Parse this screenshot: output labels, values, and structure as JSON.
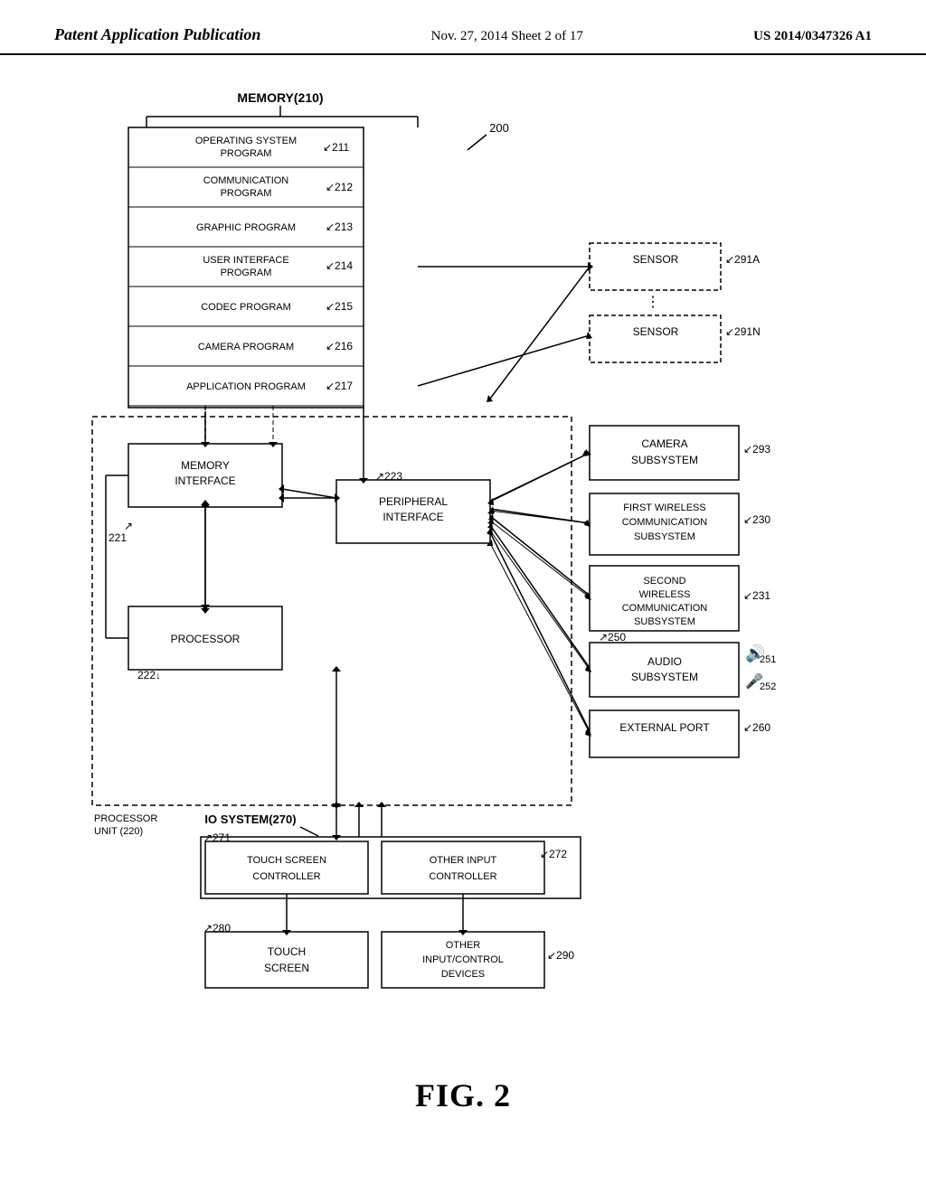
{
  "header": {
    "left": "Patent Application Publication",
    "center": "Nov. 27, 2014   Sheet 2 of 17",
    "right": "US 2014/0347326 A1"
  },
  "figure": {
    "label": "FIG. 2",
    "title": "MEMORY(210)",
    "ref_200": "200",
    "memory_blocks": [
      {
        "id": "211",
        "label": "OPERATING SYSTEM PROGRAM",
        "ref": "211"
      },
      {
        "id": "212",
        "label": "COMMUNICATION PROGRAM",
        "ref": "212"
      },
      {
        "id": "213",
        "label": "GRAPHIC PROGRAM",
        "ref": "213"
      },
      {
        "id": "214",
        "label": "USER INTERFACE PROGRAM",
        "ref": "214"
      },
      {
        "id": "215",
        "label": "CODEC PROGRAM",
        "ref": "215"
      },
      {
        "id": "216",
        "label": "CAMERA PROGRAM",
        "ref": "216"
      },
      {
        "id": "217",
        "label": "APPLICATION PROGRAM",
        "ref": "217"
      }
    ],
    "sensor_291a": "SENSOR",
    "sensor_291a_ref": "291A",
    "sensor_291n": "SENSOR",
    "sensor_291n_ref": "291N",
    "memory_interface": "MEMORY INTERFACE",
    "mi_ref": "221",
    "peripheral_interface": "PERIPHERAL INTERFACE",
    "pi_ref": "223",
    "processor": "PROCESSOR",
    "proc_ref": "222",
    "camera_sub": "CAMERA SUBSYSTEM",
    "camera_ref": "293",
    "first_wireless": "FIRST WIRELESS COMMUNICATION SUBSYSTEM",
    "first_ref": "230",
    "second_wireless": "SECOND WIRELESS COMMUNICATION SUBSYSTEM",
    "second_ref": "231",
    "audio_sub": "AUDIO SUBSYSTEM",
    "audio_ref": "250",
    "external_port": "EXTERNAL PORT",
    "ext_ref": "260",
    "io_system": "IO SYSTEM(270)",
    "touch_ctrl": "TOUCH SCREEN CONTROLLER",
    "touch_ctrl_ref": "271",
    "other_ctrl": "OTHER INPUT CONTROLLER",
    "other_ctrl_ref": "272",
    "touch_screen": "TOUCH SCREEN",
    "touch_ref": "280",
    "other_devices": "OTHER INPUT/CONTROL DEVICES",
    "other_dev_ref": "290",
    "proc_unit": "PROCESSOR UNIT (220)",
    "ref_251": "251",
    "ref_252": "252"
  }
}
